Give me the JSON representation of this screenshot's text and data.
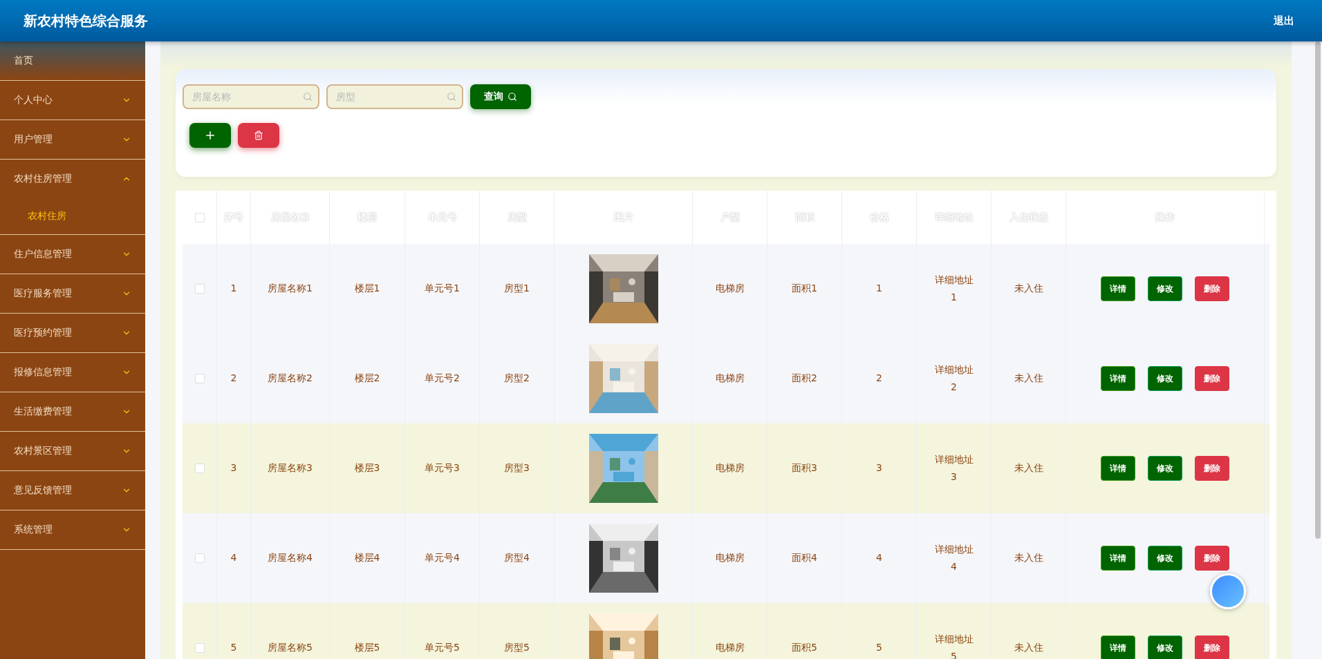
{
  "header": {
    "title": "新农村特色综合服务",
    "logout": "退出"
  },
  "sidebar": {
    "items": [
      {
        "kind": "link",
        "label": "首页"
      },
      {
        "kind": "menu",
        "label": "个人中心",
        "expanded": false
      },
      {
        "kind": "menu",
        "label": "用户管理",
        "expanded": false
      },
      {
        "kind": "menu",
        "label": "农村住房管理",
        "expanded": true,
        "children": [
          {
            "label": "农村住房",
            "selected": true
          }
        ]
      },
      {
        "kind": "menu",
        "label": "住户信息管理",
        "expanded": false
      },
      {
        "kind": "menu",
        "label": "医疗服务管理",
        "expanded": false
      },
      {
        "kind": "menu",
        "label": "医疗预约管理",
        "expanded": false
      },
      {
        "kind": "menu",
        "label": "报修信息管理",
        "expanded": false
      },
      {
        "kind": "menu",
        "label": "生活缴费管理",
        "expanded": false
      },
      {
        "kind": "menu",
        "label": "农村景区管理",
        "expanded": false
      },
      {
        "kind": "menu",
        "label": "意见反馈管理",
        "expanded": false
      },
      {
        "kind": "menu",
        "label": "系统管理",
        "expanded": false
      }
    ]
  },
  "search": {
    "fields": [
      {
        "placeholder": "房屋名称"
      },
      {
        "placeholder": "房型"
      }
    ],
    "query_button": "查询"
  },
  "table": {
    "select_all_checked": false,
    "columns": [
      "序号",
      "房屋名称",
      "楼层",
      "单元号",
      "房型",
      "图片",
      "户型",
      "面积",
      "价格",
      "详细地址",
      "入住状态",
      "操作"
    ],
    "rows": [
      {
        "checked": false,
        "highlighted": false,
        "index": "1",
        "name": "房屋名称1",
        "floor": "楼层1",
        "unit": "单元号1",
        "room_type": "房型1",
        "layout": "电梯房",
        "area": "面积1",
        "price": "1",
        "address": "详细地址1",
        "status": "未入住",
        "actions": [
          "详情",
          "修改",
          "删除"
        ]
      },
      {
        "checked": false,
        "highlighted": false,
        "index": "2",
        "name": "房屋名称2",
        "floor": "楼层2",
        "unit": "单元号2",
        "room_type": "房型2",
        "layout": "电梯房",
        "area": "面积2",
        "price": "2",
        "address": "详细地址2",
        "status": "未入住",
        "actions": [
          "详情",
          "修改",
          "删除"
        ]
      },
      {
        "checked": false,
        "highlighted": true,
        "index": "3",
        "name": "房屋名称3",
        "floor": "楼层3",
        "unit": "单元号3",
        "room_type": "房型3",
        "layout": "电梯房",
        "area": "面积3",
        "price": "3",
        "address": "详细地址3",
        "status": "未入住",
        "actions": [
          "详情",
          "修改",
          "删除"
        ]
      },
      {
        "checked": false,
        "highlighted": false,
        "index": "4",
        "name": "房屋名称4",
        "floor": "楼层4",
        "unit": "单元号4",
        "room_type": "房型4",
        "layout": "电梯房",
        "area": "面积4",
        "price": "4",
        "address": "详细地址4",
        "status": "未入住",
        "actions": [
          "详情",
          "修改",
          "删除"
        ]
      },
      {
        "checked": false,
        "highlighted": true,
        "index": "5",
        "name": "房屋名称5",
        "floor": "楼层5",
        "unit": "单元号5",
        "room_type": "房型5",
        "layout": "电梯房",
        "area": "面积5",
        "price": "5",
        "address": "详细地址5",
        "status": "未入住",
        "actions": [
          "详情",
          "修改",
          "删除"
        ]
      }
    ]
  }
}
